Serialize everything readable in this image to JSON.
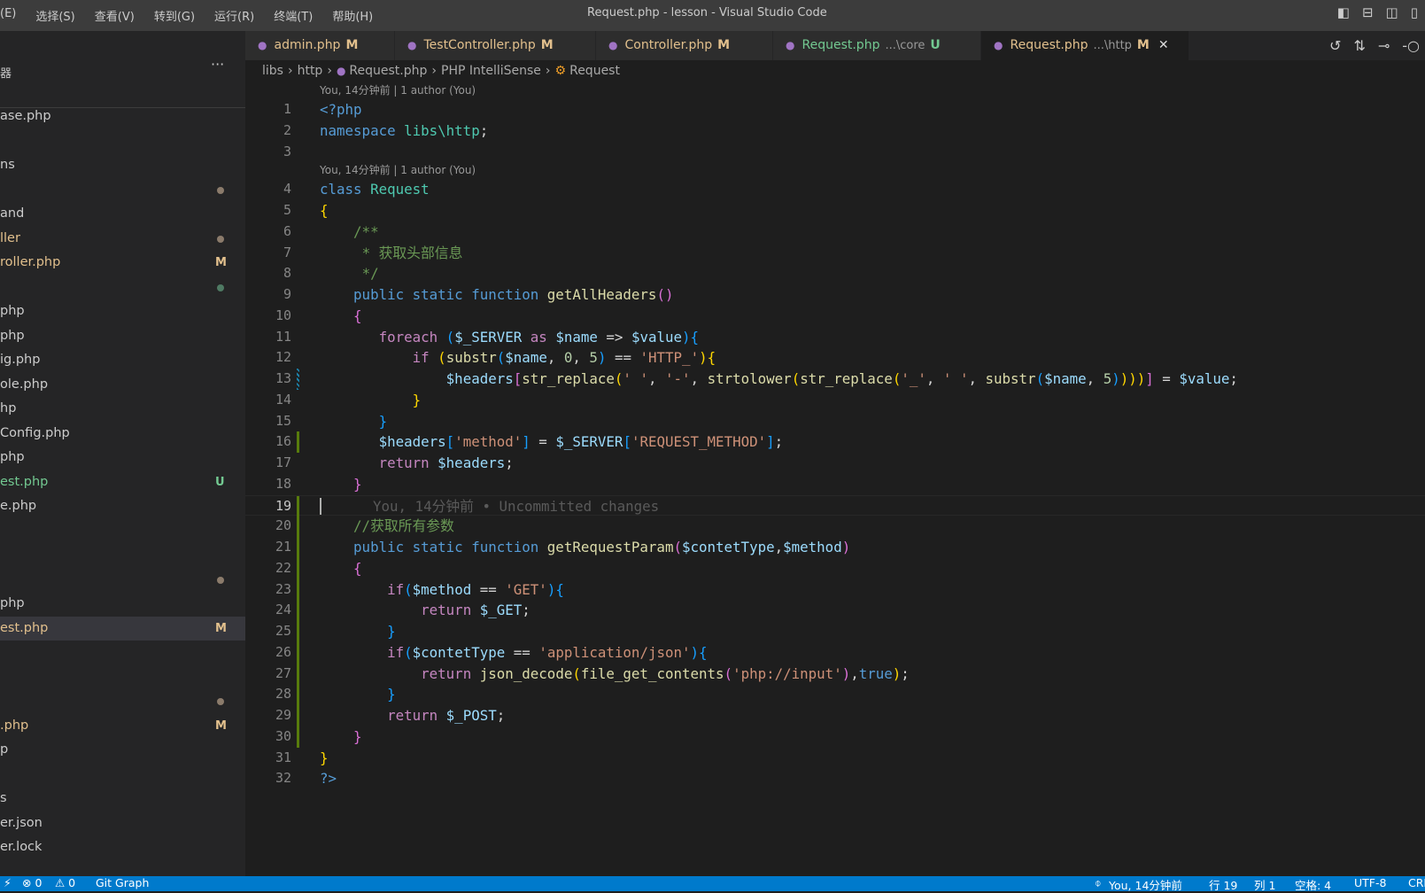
{
  "titlebar": {
    "menu": [
      "(E)",
      "选择(S)",
      "查看(V)",
      "转到(G)",
      "运行(R)",
      "终端(T)",
      "帮助(H)"
    ],
    "title": "Request.php - lesson - Visual Studio Code"
  },
  "sidebar": {
    "header": "器",
    "more": "···",
    "items": [
      {
        "label": "ase.php",
        "color": "#cccccc"
      },
      {
        "label": "",
        "color": "#cccccc"
      },
      {
        "label": "ns",
        "color": "#cccccc"
      },
      {
        "label": "",
        "color": "#cccccc",
        "dot": "#8b7b6b"
      },
      {
        "label": "and",
        "color": "#cccccc"
      },
      {
        "label": "ller",
        "color": "#e2c08d",
        "dot": "#8b7b6b"
      },
      {
        "label": "roller.php",
        "color": "#e2c08d",
        "badge": "M",
        "badge_color": "#e2c08d"
      },
      {
        "label": "",
        "color": "#cccccc",
        "dot": "#4f7a63"
      },
      {
        "label": "php",
        "color": "#cccccc"
      },
      {
        "label": "php",
        "color": "#cccccc"
      },
      {
        "label": "ig.php",
        "color": "#cccccc"
      },
      {
        "label": "ole.php",
        "color": "#cccccc"
      },
      {
        "label": "hp",
        "color": "#cccccc"
      },
      {
        "label": "Config.php",
        "color": "#cccccc"
      },
      {
        "label": "php",
        "color": "#cccccc"
      },
      {
        "label": "est.php",
        "color": "#73c991",
        "badge": "U",
        "badge_color": "#73c991"
      },
      {
        "label": "e.php",
        "color": "#cccccc"
      },
      {
        "label": "",
        "color": "#cccccc"
      },
      {
        "label": "",
        "color": "#cccccc"
      },
      {
        "label": "",
        "color": "#cccccc",
        "dot": "#8b7b6b"
      },
      {
        "label": "php",
        "color": "#cccccc"
      },
      {
        "label": "est.php",
        "color": "#e2c08d",
        "badge": "M",
        "badge_color": "#e2c08d",
        "selected": true
      },
      {
        "label": "",
        "color": "#cccccc"
      },
      {
        "label": "",
        "color": "#cccccc"
      },
      {
        "label": "",
        "color": "#cccccc",
        "dot": "#8b7b6b"
      },
      {
        "label": ".php",
        "color": "#e2c08d",
        "badge": "M",
        "badge_color": "#e2c08d"
      },
      {
        "label": "p",
        "color": "#cccccc"
      },
      {
        "label": "",
        "color": "#cccccc"
      },
      {
        "label": "s",
        "color": "#cccccc"
      },
      {
        "label": "er.json",
        "color": "#cccccc"
      },
      {
        "label": "er.lock",
        "color": "#cccccc"
      }
    ]
  },
  "tabs": [
    {
      "label": "admin.php",
      "desc": "",
      "status": "M",
      "color": "#e2c08d"
    },
    {
      "label": "TestController.php",
      "desc": "",
      "status": "M",
      "color": "#e2c08d"
    },
    {
      "label": "Controller.php",
      "desc": "",
      "status": "M",
      "color": "#e2c08d"
    },
    {
      "label": "Request.php",
      "desc": "...\\core",
      "status": "U",
      "color": "#73c991"
    },
    {
      "label": "Request.php",
      "desc": "...\\http",
      "status": "M",
      "color": "#e2c08d",
      "active": true,
      "close": "✕"
    }
  ],
  "editor_actions": [
    "history-icon",
    "compare-changes-icon",
    "go-back-icon",
    "go-forward-icon"
  ],
  "breadcrumb": [
    "libs",
    "http",
    "Request.php",
    "PHP IntelliSense",
    "Request"
  ],
  "codelens": "You, 14分钟前 | 1 author (You)",
  "blame": "You, 14分钟前 • Uncommitted changes",
  "code": [
    {
      "n": "1",
      "t": [
        [
          "k",
          "<?php"
        ]
      ]
    },
    {
      "n": "2",
      "t": [
        [
          "k",
          "namespace "
        ],
        [
          "t",
          "libs\\http"
        ],
        [
          "p",
          ";"
        ]
      ]
    },
    {
      "n": "3",
      "t": []
    },
    {
      "n": "4",
      "lens": true,
      "t": [
        [
          "k",
          "class "
        ],
        [
          "t",
          "Request"
        ]
      ]
    },
    {
      "n": "5",
      "t": [
        [
          "b1",
          "{"
        ]
      ]
    },
    {
      "n": "6",
      "t": [
        [
          "p",
          "    "
        ],
        [
          "m",
          "/**"
        ]
      ]
    },
    {
      "n": "7",
      "t": [
        [
          "p",
          "     "
        ],
        [
          "m",
          "* 获取头部信息"
        ]
      ]
    },
    {
      "n": "8",
      "t": [
        [
          "p",
          "     "
        ],
        [
          "m",
          "*/"
        ]
      ]
    },
    {
      "n": "9",
      "t": [
        [
          "p",
          "    "
        ],
        [
          "k",
          "public static function "
        ],
        [
          "f",
          "getAllHeaders"
        ],
        [
          "b2",
          "()"
        ]
      ]
    },
    {
      "n": "10",
      "t": [
        [
          "p",
          "    "
        ],
        [
          "b2",
          "{"
        ]
      ]
    },
    {
      "n": "11",
      "t": [
        [
          "p",
          "       "
        ],
        [
          "c",
          "foreach "
        ],
        [
          "b3",
          "("
        ],
        [
          "v",
          "$_SERVER "
        ],
        [
          "c",
          "as "
        ],
        [
          "v",
          "$name "
        ],
        [
          "p",
          "=> "
        ],
        [
          "v",
          "$value"
        ],
        [
          "b3",
          "){"
        ]
      ]
    },
    {
      "n": "12",
      "t": [
        [
          "p",
          "           "
        ],
        [
          "c",
          "if "
        ],
        [
          "b1",
          "("
        ],
        [
          "f",
          "substr"
        ],
        [
          "b3",
          "("
        ],
        [
          "v",
          "$name"
        ],
        [
          "p",
          ", "
        ],
        [
          "n",
          "0"
        ],
        [
          "p",
          ", "
        ],
        [
          "n",
          "5"
        ],
        [
          "b3",
          ")"
        ],
        [
          "p",
          " == "
        ],
        [
          "s",
          "'HTTP_'"
        ],
        [
          "b1",
          "){"
        ]
      ]
    },
    {
      "n": "13",
      "git": "mod",
      "t": [
        [
          "p",
          "               "
        ],
        [
          "v",
          "$headers"
        ],
        [
          "b2",
          "["
        ],
        [
          "f",
          "str_replace"
        ],
        [
          "b1",
          "("
        ],
        [
          "s",
          "' '"
        ],
        [
          "p",
          ", "
        ],
        [
          "s",
          "'-'"
        ],
        [
          "p",
          ", "
        ],
        [
          "f",
          "strtolower"
        ],
        [
          "b1",
          "("
        ],
        [
          "f",
          "str_replace"
        ],
        [
          "b1",
          "("
        ],
        [
          "s",
          "'_'"
        ],
        [
          "p",
          ", "
        ],
        [
          "s",
          "' '"
        ],
        [
          "p",
          ", "
        ],
        [
          "f",
          "substr"
        ],
        [
          "b3",
          "("
        ],
        [
          "v",
          "$name"
        ],
        [
          "p",
          ", "
        ],
        [
          "n",
          "5"
        ],
        [
          "b3",
          ")"
        ],
        [
          "b1",
          ")))"
        ],
        [
          "b2",
          "]"
        ],
        [
          "p",
          " = "
        ],
        [
          "v",
          "$value"
        ],
        [
          "p",
          ";"
        ]
      ]
    },
    {
      "n": "14",
      "t": [
        [
          "p",
          "           "
        ],
        [
          "b1",
          "}"
        ]
      ]
    },
    {
      "n": "15",
      "t": [
        [
          "p",
          "       "
        ],
        [
          "b3",
          "}"
        ]
      ]
    },
    {
      "n": "16",
      "git": "add",
      "t": [
        [
          "p",
          "       "
        ],
        [
          "v",
          "$headers"
        ],
        [
          "b3",
          "["
        ],
        [
          "s",
          "'method'"
        ],
        [
          "b3",
          "]"
        ],
        [
          "p",
          " = "
        ],
        [
          "v",
          "$_SERVER"
        ],
        [
          "b3",
          "["
        ],
        [
          "s",
          "'REQUEST_METHOD'"
        ],
        [
          "b3",
          "]"
        ],
        [
          "p",
          ";"
        ]
      ]
    },
    {
      "n": "17",
      "t": [
        [
          "p",
          "       "
        ],
        [
          "c",
          "return "
        ],
        [
          "v",
          "$headers"
        ],
        [
          "p",
          ";"
        ]
      ]
    },
    {
      "n": "18",
      "t": [
        [
          "p",
          "    "
        ],
        [
          "b2",
          "}"
        ]
      ]
    },
    {
      "n": "19",
      "git": "add",
      "current": true,
      "t": []
    },
    {
      "n": "20",
      "git": "add",
      "t": [
        [
          "p",
          "    "
        ],
        [
          "m",
          "//获取所有参数"
        ]
      ]
    },
    {
      "n": "21",
      "git": "add",
      "t": [
        [
          "p",
          "    "
        ],
        [
          "k",
          "public static function "
        ],
        [
          "f",
          "getRequestParam"
        ],
        [
          "b2",
          "("
        ],
        [
          "v",
          "$contetType"
        ],
        [
          "p",
          ","
        ],
        [
          "v",
          "$method"
        ],
        [
          "b2",
          ")"
        ]
      ]
    },
    {
      "n": "22",
      "git": "add",
      "t": [
        [
          "p",
          "    "
        ],
        [
          "b2",
          "{"
        ]
      ]
    },
    {
      "n": "23",
      "git": "add",
      "t": [
        [
          "p",
          "        "
        ],
        [
          "c",
          "if"
        ],
        [
          "b3",
          "("
        ],
        [
          "v",
          "$method"
        ],
        [
          "p",
          " == "
        ],
        [
          "s",
          "'GET'"
        ],
        [
          "b3",
          "){"
        ]
      ]
    },
    {
      "n": "24",
      "git": "add",
      "t": [
        [
          "p",
          "            "
        ],
        [
          "c",
          "return "
        ],
        [
          "v",
          "$_GET"
        ],
        [
          "p",
          ";"
        ]
      ]
    },
    {
      "n": "25",
      "git": "add",
      "t": [
        [
          "p",
          "        "
        ],
        [
          "b3",
          "}"
        ]
      ]
    },
    {
      "n": "26",
      "git": "add",
      "t": [
        [
          "p",
          "        "
        ],
        [
          "c",
          "if"
        ],
        [
          "b3",
          "("
        ],
        [
          "v",
          "$contetType"
        ],
        [
          "p",
          " == "
        ],
        [
          "s",
          "'application/json'"
        ],
        [
          "b3",
          "){"
        ]
      ]
    },
    {
      "n": "27",
      "git": "add",
      "t": [
        [
          "p",
          "            "
        ],
        [
          "c",
          "return "
        ],
        [
          "f",
          "json_decode"
        ],
        [
          "b1",
          "("
        ],
        [
          "f",
          "file_get_contents"
        ],
        [
          "b2",
          "("
        ],
        [
          "s",
          "'php://input'"
        ],
        [
          "b2",
          ")"
        ],
        [
          "p",
          ","
        ],
        [
          "k",
          "true"
        ],
        [
          "b1",
          ")"
        ],
        [
          "p",
          ";"
        ]
      ]
    },
    {
      "n": "28",
      "git": "add",
      "t": [
        [
          "p",
          "        "
        ],
        [
          "b3",
          "}"
        ]
      ]
    },
    {
      "n": "29",
      "git": "add",
      "t": [
        [
          "p",
          "        "
        ],
        [
          "c",
          "return "
        ],
        [
          "v",
          "$_POST"
        ],
        [
          "p",
          ";"
        ]
      ]
    },
    {
      "n": "30",
      "git": "add",
      "t": [
        [
          "p",
          "    "
        ],
        [
          "b2",
          "}"
        ]
      ]
    },
    {
      "n": "31",
      "t": [
        [
          "b1",
          "}"
        ]
      ]
    },
    {
      "n": "32",
      "t": [
        [
          "k",
          "?>"
        ]
      ]
    }
  ],
  "statusbar": {
    "errors": "⊗ 0",
    "warnings": "⚠ 0",
    "git_graph": "Git Graph",
    "blame": "You, 14分钟前",
    "line": "行 19",
    "col": "列 1",
    "spaces": "空格: 4",
    "encoding": "UTF-8",
    "eol": "CRLF",
    "color": "#007acc"
  }
}
